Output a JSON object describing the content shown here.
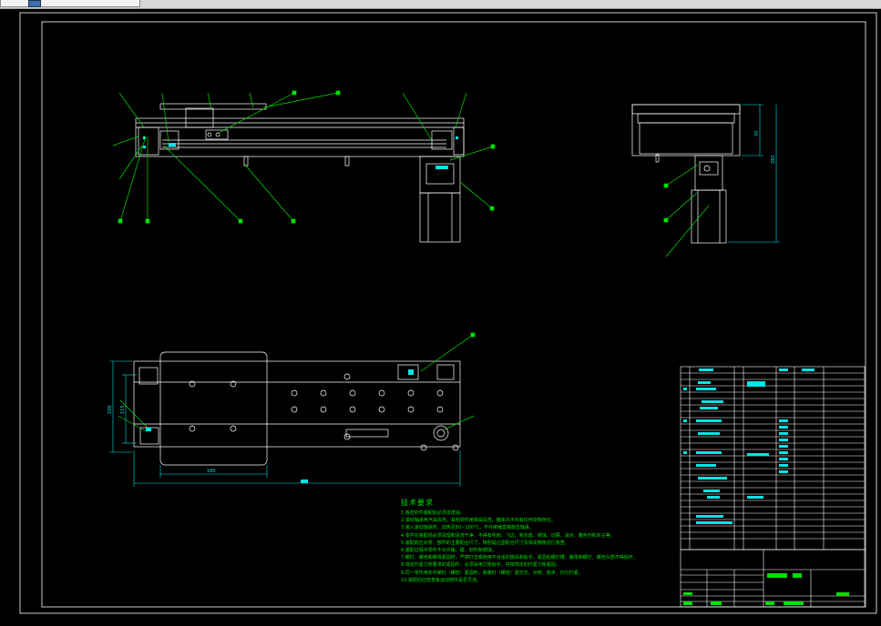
{
  "window": {
    "tab_icon": "drawing-file-icon"
  },
  "drawing": {
    "colors": {
      "background": "#000000",
      "outline": "#ffffff",
      "leader": "#00e000",
      "dimension": "#00e6e6",
      "fill": "#00e6e6",
      "highlight": "#00e000"
    },
    "dimensions": {
      "top_view_total_width": "",
      "top_view_plate_width": "180",
      "top_view_height_outer": "106",
      "top_view_height_inner": "115",
      "side_view_height_1": "70",
      "side_view_height_2": "282"
    },
    "technical_notes": {
      "title": "技术要求",
      "lines": [
        "1.各密封件装配前必须浸透油。",
        "2.滚动轴承用汽油清洗，其他零件用煤油清洗，箱体内不许有任何杂物存在。",
        "3.装入滚动轴承时，加热至80~100°C，不许用锤直接敲击轴承。",
        "4.零件在装配前必须清理和清洗干净，不得有毛刺、飞边、氧化皮、锈蚀、切屑、油污、着色剂和灰尘等。",
        "5.装配前应对零、部件的主要配合尺寸，特别是过盈配合尺寸及相关精度进行复查。",
        "6.装配过程中零件不允许磕、碰、划伤和锈蚀。",
        "7.螺钉、螺栓和螺母紧固时，严禁打击或使用不合适的旋具和扳手，紧固后螺钉槽、螺母和螺钉、螺栓头部不得损坏。",
        "8.规定拧紧力矩要求的紧固件，必须采用力矩扳手，并按规定的拧紧力矩紧固。",
        "9.同一零件用多件螺钉（螺栓）紧固时，各螺钉（螺栓）需交叉、对称、逐步、均匀拧紧。",
        "10.装配后应检查各运动部件是否灵活。"
      ]
    }
  }
}
